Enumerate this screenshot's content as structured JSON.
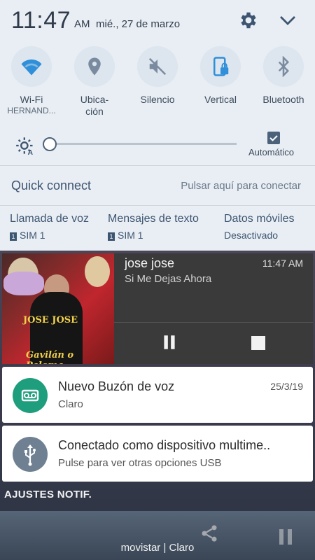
{
  "status": {
    "clock": "11:47",
    "ampm": "AM",
    "date": "mié., 27 de marzo",
    "icons": [
      "gear-icon",
      "chevron-down-icon"
    ]
  },
  "tiles": [
    {
      "label": "Wi-Fi",
      "sublabel": "HERNAND...",
      "icon": "wifi-icon",
      "active": true
    },
    {
      "label": "Ubica-\nción",
      "sublabel": "",
      "icon": "location-icon",
      "active": false
    },
    {
      "label": "Silencio",
      "sublabel": "",
      "icon": "mute-icon",
      "active": false
    },
    {
      "label": "Vertical",
      "sublabel": "",
      "icon": "rotation-lock-icon",
      "active": true
    },
    {
      "label": "Bluetooth",
      "sublabel": "",
      "icon": "bluetooth-icon",
      "active": false
    }
  ],
  "brightness": {
    "level": 0.0,
    "auto_label": "Automático",
    "auto_checked": true
  },
  "quick_connect": {
    "title": "Quick connect",
    "hint": "Pulsar aquí para conectar"
  },
  "sim": {
    "voice": {
      "title": "Llamada de voz",
      "sub": "SIM 1",
      "badge": "1"
    },
    "sms": {
      "title": "Mensajes de texto",
      "sub": "SIM 1",
      "badge": "1"
    },
    "data": {
      "title": "Datos móviles",
      "sub": "Desactivado"
    }
  },
  "media": {
    "artist": "jose jose",
    "song": "Si Me Dejas Ahora",
    "time": "11:47 AM",
    "album_text_top": "JOSE JOSE",
    "album_text_bottom": "Gavilán o Paloma"
  },
  "notifications": [
    {
      "title": "Nuevo Buzón de voz",
      "sub": "Claro",
      "date": "25/3/19",
      "icon": "voicemail-icon",
      "color": "#1e9e7c"
    },
    {
      "title": "Conectado como dispositivo multime..",
      "sub": "Pulse para ver otras opciones USB",
      "date": "",
      "icon": "usb-icon",
      "color": "#6f8093"
    }
  ],
  "notif_settings_label": "AJUSTES NOTIF.",
  "carrier": "movistar | Claro",
  "colors": {
    "panel_bg": "#e9eef4",
    "accent": "#2f8fd8",
    "voicemail": "#1e9e7c",
    "usb": "#6f8093"
  }
}
